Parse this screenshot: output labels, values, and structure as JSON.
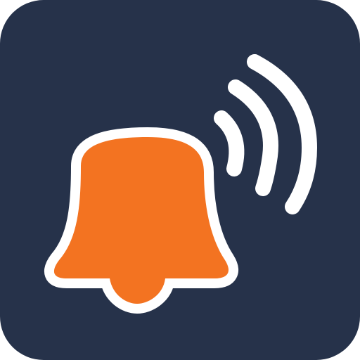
{
  "icon": {
    "name": "bell-ringing-app-icon",
    "symbol": "bell-icon",
    "signal": "sound-waves-icon",
    "colors": {
      "tile": "#26324A",
      "bell": "#F37321",
      "outline": "#FFFFFF",
      "waves": "#FFFFFF",
      "page": "#FFFFFF"
    }
  }
}
